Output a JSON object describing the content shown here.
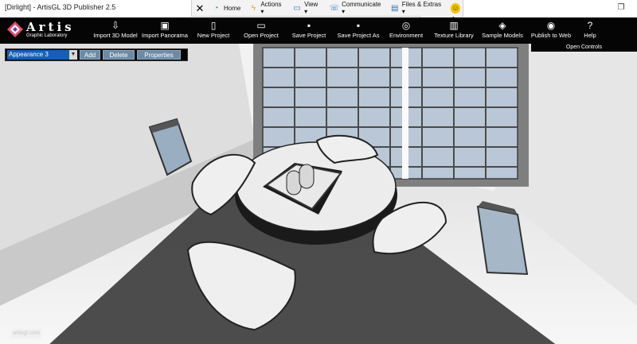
{
  "window": {
    "title": "[Dirlight] - ArtisGL 3D Publisher 2.5",
    "close_glyph": "✕",
    "restore_glyph": "❐"
  },
  "float_toolbar": {
    "items": [
      {
        "label": "Home",
        "icon": "home-icon"
      },
      {
        "label": "Actions ▾",
        "icon": "lightning-icon"
      },
      {
        "label": "View ▾",
        "icon": "monitor-icon"
      },
      {
        "label": "Communicate ▾",
        "icon": "phone-icon"
      },
      {
        "label": "Files & Extras ▾",
        "icon": "folder-icon"
      }
    ],
    "sub_glyphs": "▪ ▪ ─ ⌃"
  },
  "app": {
    "logo_name": "Artis",
    "logo_sub": "Graphic Laboratory",
    "tools": [
      {
        "label": "Import 3D Model",
        "icon": "import-model-icon",
        "glyph": "⇩"
      },
      {
        "label": "Import Panorama",
        "icon": "panorama-icon",
        "glyph": "▣"
      },
      {
        "label": "New Project",
        "icon": "new-project-icon",
        "glyph": "▯"
      },
      {
        "label": "Open Project",
        "icon": "open-project-icon",
        "glyph": "▭"
      },
      {
        "label": "Save Project",
        "icon": "save-project-icon",
        "glyph": "▪"
      },
      {
        "label": "Save Project As",
        "icon": "save-as-icon",
        "glyph": "▪"
      },
      {
        "label": "Environment",
        "icon": "environment-icon",
        "glyph": "◎"
      },
      {
        "label": "Texture Library",
        "icon": "texture-library-icon",
        "glyph": "▥"
      },
      {
        "label": "Sample Models",
        "icon": "sample-models-icon",
        "glyph": "◈"
      },
      {
        "label": "Publish to Web",
        "icon": "publish-web-icon",
        "glyph": "◉"
      },
      {
        "label": "Help",
        "icon": "help-icon",
        "glyph": "?"
      }
    ],
    "open_controls": "Open Controls"
  },
  "appearance_panel": {
    "selected": "Appearance 3",
    "add_label": "Add",
    "delete_label": "Delete",
    "properties_label": "Properties"
  },
  "watermark": "artisgl.com",
  "colors": {
    "bar_bg": "#050505",
    "select_bg": "#1560b7",
    "button_bg": "#6b8aa6"
  }
}
